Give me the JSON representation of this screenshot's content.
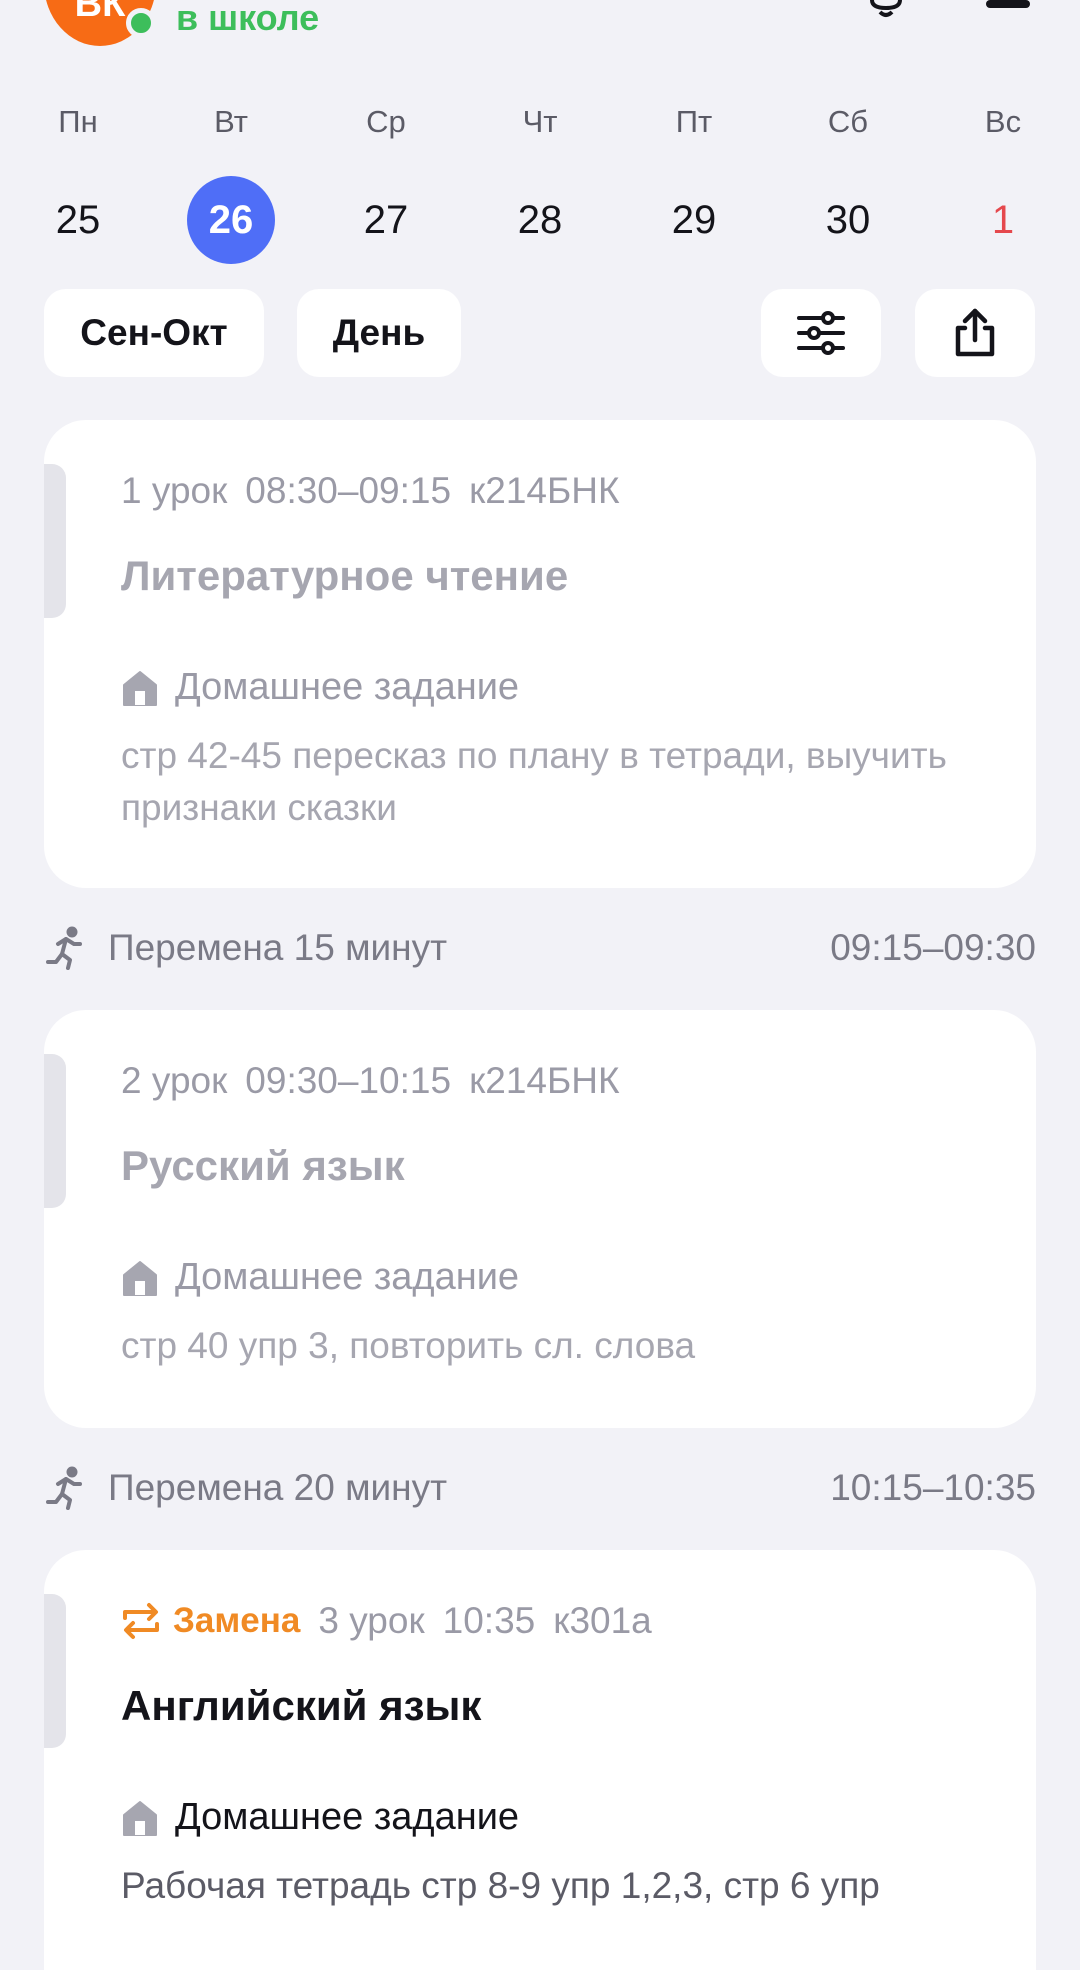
{
  "header": {
    "avatar_initials": "ВК",
    "status": "в школе",
    "icons": {
      "notifications": "bell-icon",
      "menu": "menu-icon"
    }
  },
  "week": {
    "days": [
      {
        "dow": "Пн",
        "date": "25"
      },
      {
        "dow": "Вт",
        "date": "26"
      },
      {
        "dow": "Ср",
        "date": "27"
      },
      {
        "dow": "Чт",
        "date": "28"
      },
      {
        "dow": "Пт",
        "date": "29"
      },
      {
        "dow": "Сб",
        "date": "30"
      },
      {
        "dow": "Вс",
        "date": "1"
      }
    ],
    "selected_date": "26"
  },
  "controls": {
    "period_label": "Сен-Окт",
    "view_label": "День",
    "icons": {
      "filter": "sliders-icon",
      "share": "share-icon"
    }
  },
  "lessons": [
    {
      "number": "1 урок",
      "time": "08:30–09:15",
      "room": "к214БНК",
      "subject": "Литературное чтение",
      "hw_label": "Домашнее задание",
      "hw_text": "стр 42-45 пересказ по плану в тетради, выучить признаки сказки"
    },
    {
      "number": "2 урок",
      "time": "09:30–10:15",
      "room": "к214БНК",
      "subject": "Русский язык",
      "hw_label": "Домашнее задание",
      "hw_text": "стр 40 упр 3, повторить сл. слова"
    },
    {
      "replacement": "Замена",
      "number": "3 урок",
      "time": "10:35",
      "room": "к301а",
      "subject": "Английский язык",
      "hw_label": "Домашнее задание",
      "hw_text": "Рабочая тетрадь стр 8-9 упр 1,2,3,  стр 6 упр"
    }
  ],
  "breaks": [
    {
      "label": "Перемена 15 минут",
      "time": "09:15–09:30"
    },
    {
      "label": "Перемена 20 минут",
      "time": "10:15–10:35"
    }
  ],
  "colors": {
    "background": "#F2F2F7",
    "accent_blue": "#4F6EF7",
    "online_green": "#3DBE5B",
    "avatar_orange": "#F76B15",
    "replacement_orange": "#F08A24",
    "sunday_red": "#E5484D"
  }
}
